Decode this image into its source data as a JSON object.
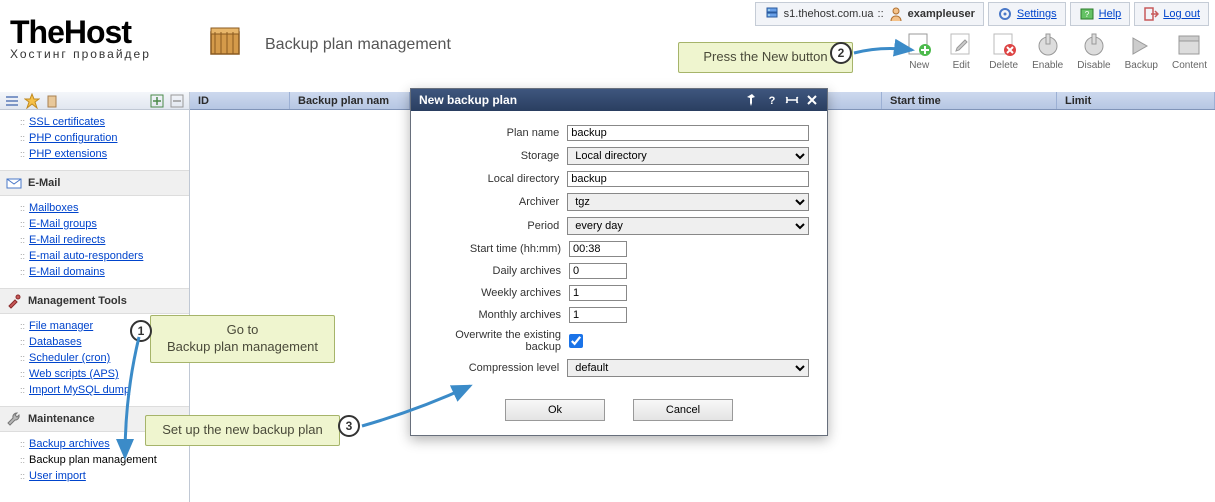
{
  "top": {
    "host_label": "s1.thehost.com.ua",
    "sep": "::",
    "user": "exampleuser",
    "settings": "Settings",
    "help": "Help",
    "logout": "Log out"
  },
  "brand": {
    "main": "TheHost",
    "sub": "Хостинг провайдер"
  },
  "page_title": "Backup plan management",
  "toolbar": {
    "new": "New",
    "edit": "Edit",
    "delete": "Delete",
    "enable": "Enable",
    "disable": "Disable",
    "backup": "Backup",
    "content": "Content"
  },
  "callouts": {
    "c1_line1": "Go to",
    "c1_line2": "Backup plan management",
    "c2": "Press the New button",
    "c3": "Set up the new backup plan"
  },
  "nav": {
    "www_items": [
      "SSL certificates",
      "PHP configuration",
      "PHP extensions"
    ],
    "email_head": "E-Mail",
    "email_items": [
      "Mailboxes",
      "E-Mail groups",
      "E-Mail redirects",
      "E-mail auto-responders",
      "E-Mail domains"
    ],
    "mgmt_head": "Management Tools",
    "mgmt_items": [
      "File manager",
      "Databases",
      "Scheduler (cron)",
      "Web scripts (APS)",
      "Import MySQL dump"
    ],
    "maint_head": "Maintenance",
    "maint_items": [
      "Backup archives",
      "Backup plan management",
      "User import"
    ]
  },
  "columns": {
    "id": "ID",
    "name": "Backup plan nam",
    "start": "Start time",
    "limit": "Limit"
  },
  "dialog": {
    "title": "New backup plan",
    "labels": {
      "plan_name": "Plan name",
      "storage": "Storage",
      "local_dir": "Local directory",
      "archiver": "Archiver",
      "period": "Period",
      "start_time": "Start time (hh:mm)",
      "daily": "Daily archives",
      "weekly": "Weekly archives",
      "monthly": "Monthly archives",
      "overwrite": "Overwrite the existing backup",
      "compression": "Compression level"
    },
    "values": {
      "plan_name": "backup",
      "storage": "Local directory",
      "local_dir": "backup",
      "archiver": "tgz",
      "period": "every day",
      "start_time": "00:38",
      "daily": "0",
      "weekly": "1",
      "monthly": "1",
      "overwrite": true,
      "compression": "default"
    },
    "ok": "Ok",
    "cancel": "Cancel"
  }
}
